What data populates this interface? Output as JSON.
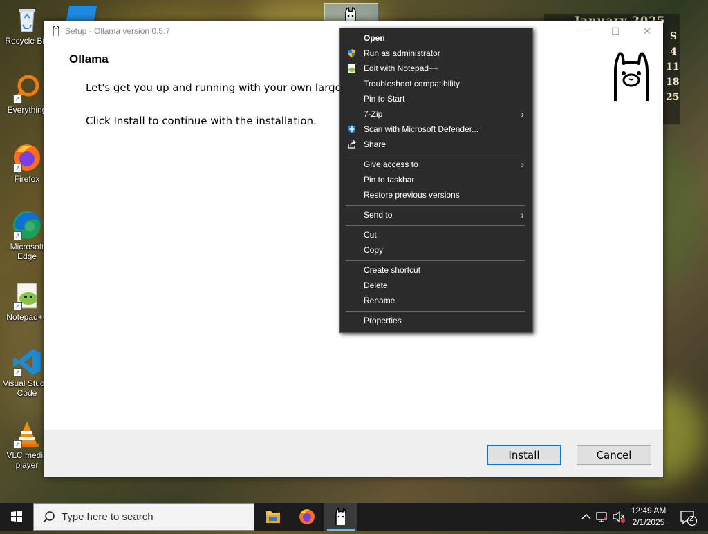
{
  "desktop": {
    "icons": [
      {
        "label": "Recycle Bin",
        "icon": "recycle-bin-icon"
      },
      {
        "label": "Everything",
        "icon": "everything-icon"
      },
      {
        "label": "Firefox",
        "icon": "firefox-icon"
      },
      {
        "label": "Microsoft Edge",
        "icon": "edge-icon"
      },
      {
        "label": "Notepad++",
        "icon": "notepadpp-icon"
      },
      {
        "label": "Visual Studio Code",
        "icon": "vscode-icon"
      },
      {
        "label": "VLC media player",
        "icon": "vlc-icon"
      }
    ]
  },
  "calendar": {
    "title": "January 2025",
    "column_header": "S",
    "days": [
      "4",
      "11",
      "18",
      "25"
    ]
  },
  "setup": {
    "title": "Setup - Ollama version 0.5.7",
    "heading": "Ollama",
    "line1": "Let's get you up and running with your own large la",
    "line2": "Click Install to continue with the installation.",
    "install_label": "Install",
    "cancel_label": "Cancel"
  },
  "context_menu": {
    "groups": [
      [
        {
          "label": "Open",
          "bold": true
        },
        {
          "label": "Run as administrator",
          "icon": "uac-shield-icon"
        },
        {
          "label": "Edit with Notepad++",
          "icon": "notepadpp-icon"
        },
        {
          "label": "Troubleshoot compatibility"
        },
        {
          "label": "Pin to Start"
        },
        {
          "label": "7-Zip",
          "submenu": true
        },
        {
          "label": "Scan with Microsoft Defender...",
          "icon": "defender-icon"
        },
        {
          "label": "Share",
          "icon": "share-icon"
        }
      ],
      [
        {
          "label": "Give access to",
          "submenu": true
        },
        {
          "label": "Pin to taskbar"
        },
        {
          "label": "Restore previous versions"
        }
      ],
      [
        {
          "label": "Send to",
          "submenu": true
        }
      ],
      [
        {
          "label": "Cut"
        },
        {
          "label": "Copy"
        }
      ],
      [
        {
          "label": "Create shortcut"
        },
        {
          "label": "Delete"
        },
        {
          "label": "Rename"
        }
      ],
      [
        {
          "label": "Properties"
        }
      ]
    ]
  },
  "taskbar": {
    "search_placeholder": "Type here to search",
    "apps": [
      "file-explorer-icon",
      "firefox-icon",
      "ollama-icon"
    ],
    "time": "12:49 AM",
    "date": "2/1/2025",
    "notification_count": "2"
  },
  "colors": {
    "accent": "#0078d7",
    "menu_bg": "#2b2b2b",
    "taskbar_bg": "#1b1b1b"
  }
}
